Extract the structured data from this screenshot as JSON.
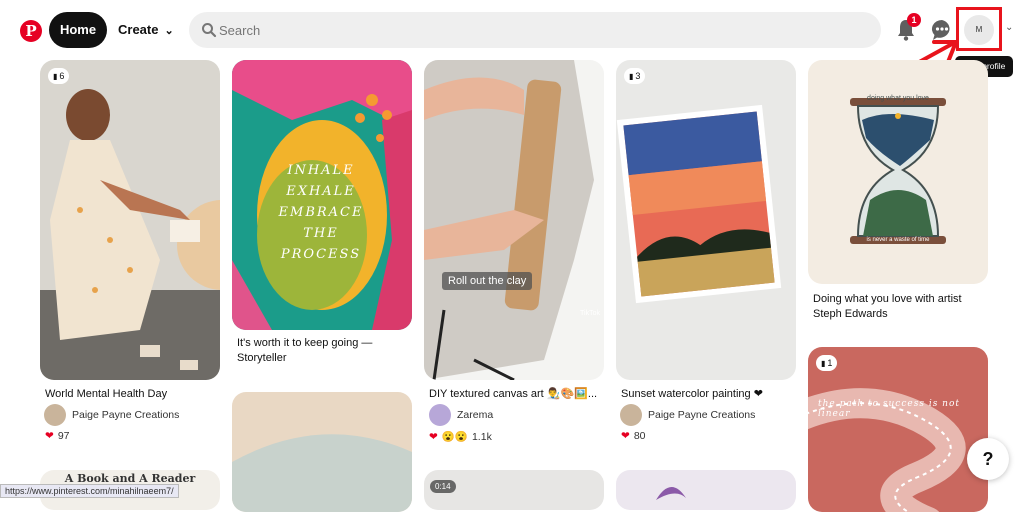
{
  "header": {
    "logo": "P",
    "home_label": "Home",
    "create_label": "Create",
    "search_placeholder": "Search",
    "notification_count": "1",
    "avatar_initial": "M",
    "tooltip": "Your profile",
    "icons": [
      "pinterest-logo-icon",
      "chevron-down-icon",
      "search-icon",
      "bell-icon",
      "chat-icon",
      "chevron-down-icon"
    ]
  },
  "pins": [
    {
      "count": "6",
      "title": "World Mental Health Day",
      "creator": "Paige Payne Creations",
      "reactions": "97"
    },
    {
      "title": "It's worth it to keep going — Storyteller",
      "image_text": "INHALE EXHALE EMBRACE THE PROCESS"
    },
    {
      "title": "DIY textured canvas art 👨‍🎨🎨🖼️...",
      "creator": "Zarema",
      "reactions": "1.1k",
      "overlay": "Roll out the clay",
      "watermark": "TikTok"
    },
    {
      "count": "3",
      "title": "Sunset watercolor painting ❤",
      "creator": "Paige Payne Creations",
      "reactions": "80"
    },
    {
      "title": "Doing what you love with artist Steph Edwards",
      "image_top": "doing what you love",
      "image_bottom": "is never a waste of time"
    },
    {
      "title": "A Book and A Reader"
    },
    {
      "duration": "0:14"
    },
    {
      "count": "1",
      "image_text": "the path to success is not linear"
    }
  ],
  "help_label": "?",
  "status_url": "https://www.pinterest.com/minahilnaeem7/",
  "colors": {
    "brand": "#e60023",
    "highlight": "#e8141c"
  }
}
